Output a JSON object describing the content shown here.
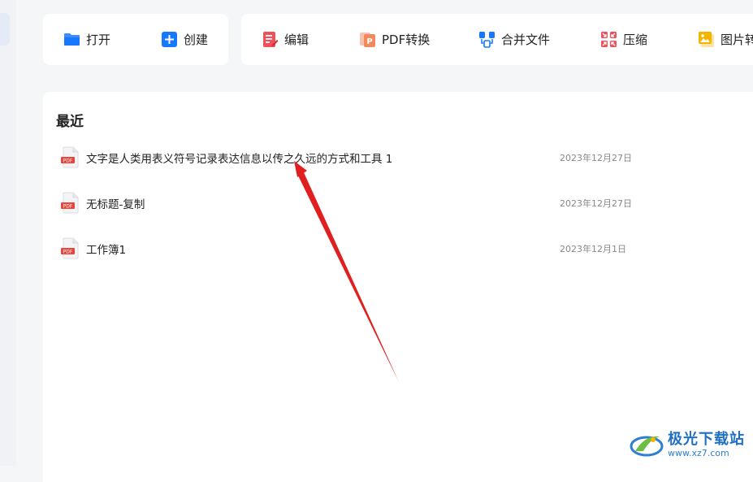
{
  "toolbar": {
    "open_label": "打开",
    "create_label": "创建",
    "edit_label": "编辑",
    "pdf_convert_label": "PDF转换",
    "merge_label": "合并文件",
    "compress_label": "压缩",
    "image_label": "图片转"
  },
  "recent": {
    "title": "最近",
    "files": [
      {
        "name": "文字是人类用表义符号记录表达信息以传之久远的方式和工具 1",
        "date": "2023年12月27日",
        "badge": "PDF"
      },
      {
        "name": "无标题-复制",
        "date": "2023年12月27日",
        "badge": "PDF"
      },
      {
        "name": "工作簿1",
        "date": "2023年12月1日",
        "badge": "PDF"
      }
    ]
  },
  "watermark": {
    "title": "极光下载站",
    "url": "www.xz7.com"
  },
  "colors": {
    "accent_blue": "#1677ff",
    "edit_red": "#f0505a",
    "pdf_orange": "#f08a5d",
    "arrow_red": "#e02020"
  }
}
